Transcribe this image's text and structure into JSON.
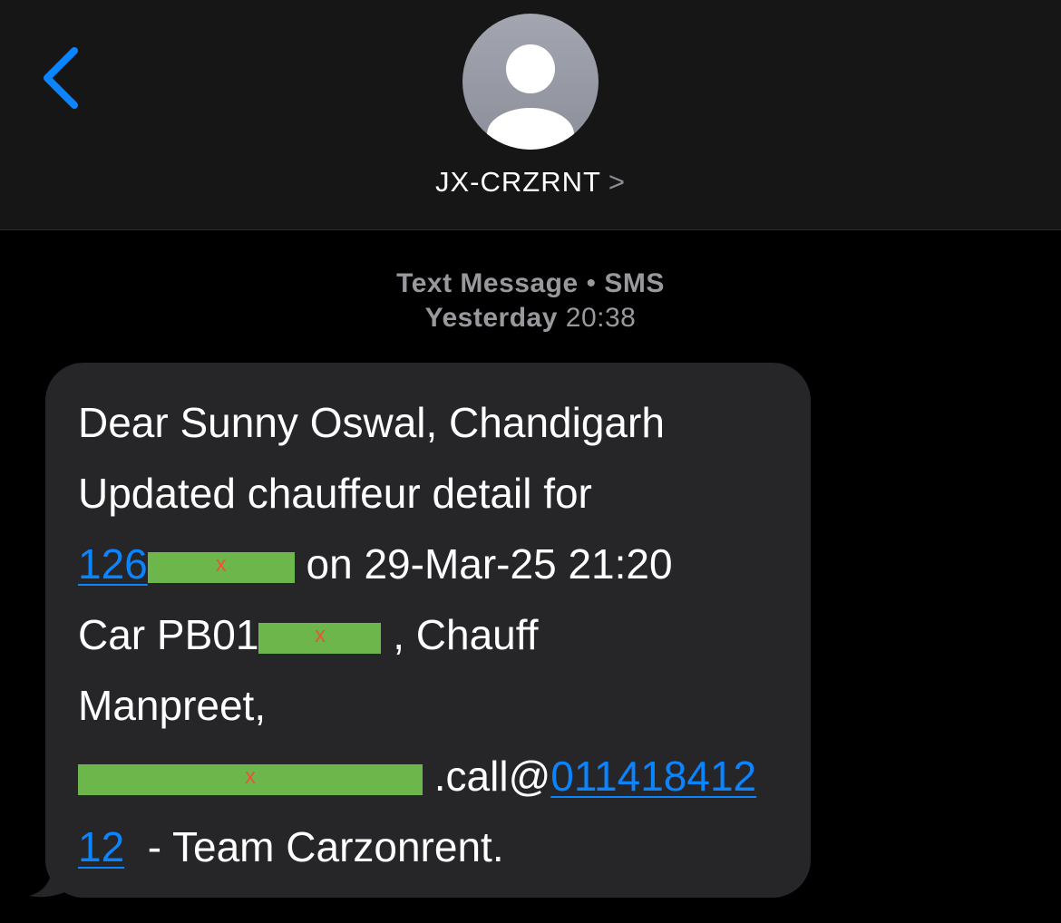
{
  "header": {
    "contact_name": "JX-CRZRNT",
    "chevron": ">",
    "back_icon": "chevron-left-icon",
    "avatar_icon": "person-silhouette-icon"
  },
  "meta": {
    "kind": "Text Message",
    "separator": " • ",
    "service": "SMS",
    "day": "Yesterday",
    "time": "20:38"
  },
  "message": {
    "line1": "Dear Sunny Oswal, Chandigarh",
    "line2": "Updated chauffeur detail for",
    "booking_prefix": "126",
    "booking_redact_mark": "x",
    "line3_rest": " on 29-Mar-25 21:20",
    "car_prefix": "Car PB01",
    "car_redact_mark": "x",
    "car_suffix": " , Chauff",
    "line5": "Manpreet,",
    "phone_redact_mark": "x",
    "call_text": " .call@",
    "call_number_part1": "011418412",
    "call_number_part2": "12",
    "sign_off": "  - Team Carzonrent."
  },
  "colors": {
    "background": "#000000",
    "header_bg": "#161616",
    "bubble_bg": "#262629",
    "link": "#0a84ff",
    "meta_text": "#98989d",
    "redaction": "#6db64b",
    "redaction_mark": "#e8553a"
  }
}
